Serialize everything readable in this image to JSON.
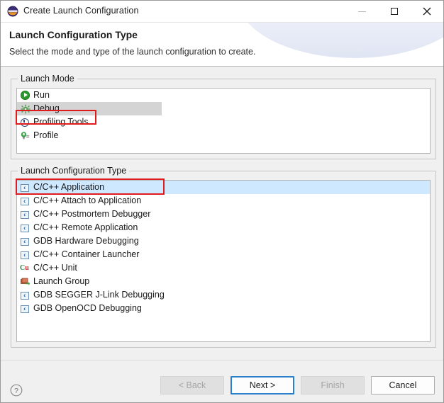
{
  "window": {
    "title": "Create Launch Configuration",
    "app_icon": "eclipse-icon",
    "controls": {
      "minimize": "minimize-icon",
      "maximize": "maximize-icon",
      "close": "close-icon"
    }
  },
  "header": {
    "title": "Launch Configuration Type",
    "subtitle": "Select the mode and type of the launch configuration to create."
  },
  "launch_mode": {
    "group_label": "Launch Mode",
    "items": [
      {
        "label": "Run",
        "icon": "run-icon",
        "selected": false
      },
      {
        "label": "Debug",
        "icon": "debug-icon",
        "selected": true
      },
      {
        "label": "Profiling Tools",
        "icon": "profiling-tools-icon",
        "selected": false
      },
      {
        "label": "Profile",
        "icon": "profile-icon",
        "selected": false
      }
    ]
  },
  "launch_config_type": {
    "group_label": "Launch Configuration Type",
    "items": [
      {
        "label": "C/C++ Application",
        "icon": "c-file-icon",
        "selected": true
      },
      {
        "label": "C/C++ Attach to Application",
        "icon": "c-file-icon",
        "selected": false
      },
      {
        "label": "C/C++ Postmortem Debugger",
        "icon": "c-file-icon",
        "selected": false
      },
      {
        "label": "C/C++ Remote Application",
        "icon": "c-file-icon",
        "selected": false
      },
      {
        "label": "GDB Hardware Debugging",
        "icon": "c-file-icon",
        "selected": false
      },
      {
        "label": "C/C++ Container Launcher",
        "icon": "c-file-icon",
        "selected": false
      },
      {
        "label": "C/C++ Unit",
        "icon": "cunit-icon",
        "selected": false
      },
      {
        "label": "Launch Group",
        "icon": "launch-group-icon",
        "selected": false
      },
      {
        "label": "GDB SEGGER J-Link Debugging",
        "icon": "c-file-icon",
        "selected": false
      },
      {
        "label": "GDB OpenOCD Debugging",
        "icon": "c-file-icon",
        "selected": false
      }
    ]
  },
  "footer": {
    "help_icon": "help-icon",
    "buttons": [
      {
        "label": "< Back",
        "state": "disabled"
      },
      {
        "label": "Next >",
        "state": "default"
      },
      {
        "label": "Finish",
        "state": "disabled"
      },
      {
        "label": "Cancel",
        "state": "enabled"
      }
    ]
  },
  "colors": {
    "annotation": "#e01b1b",
    "selection_blue": "#cde8ff",
    "selection_gray": "#d4d4d4",
    "default_button_border": "#2b7ec8"
  }
}
